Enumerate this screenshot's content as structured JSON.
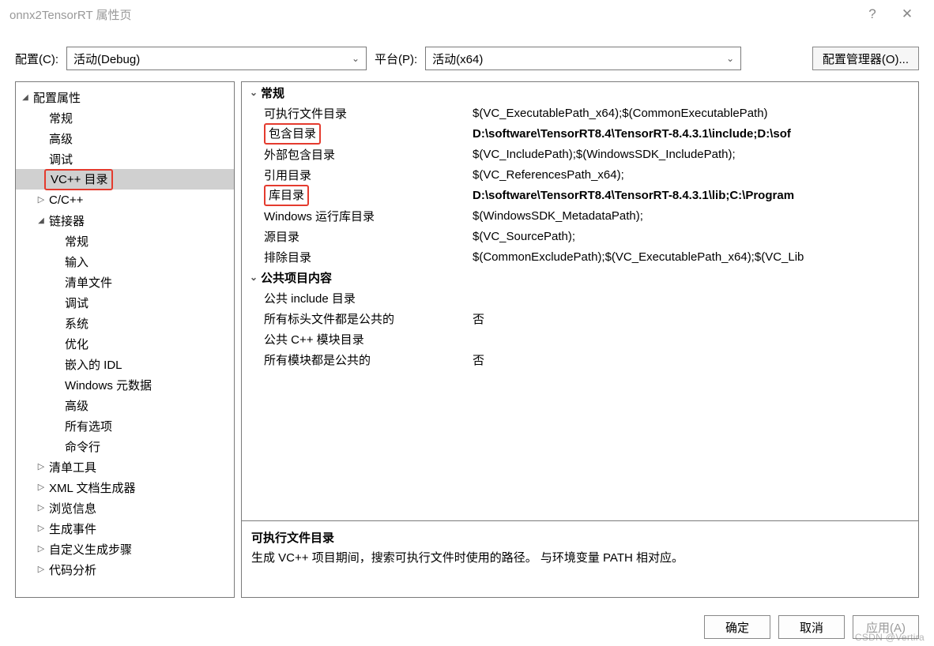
{
  "window": {
    "title": "onnx2TensorRT 属性页",
    "help_icon": "?",
    "close_icon": "✕"
  },
  "toolbar": {
    "config_label": "配置(C):",
    "config_value": "活动(Debug)",
    "platform_label": "平台(P):",
    "platform_value": "活动(x64)",
    "config_manager": "配置管理器(O)..."
  },
  "tree": [
    {
      "label": "配置属性",
      "depth": 0,
      "arrow": "open"
    },
    {
      "label": "常规",
      "depth": 1,
      "arrow": "none"
    },
    {
      "label": "高级",
      "depth": 1,
      "arrow": "none"
    },
    {
      "label": "调试",
      "depth": 1,
      "arrow": "none"
    },
    {
      "label": "VC++ 目录",
      "depth": 1,
      "arrow": "none",
      "selected": true,
      "redbox": true
    },
    {
      "label": "C/C++",
      "depth": 1,
      "arrow": "closed"
    },
    {
      "label": "链接器",
      "depth": 1,
      "arrow": "open"
    },
    {
      "label": "常规",
      "depth": 2,
      "arrow": "none"
    },
    {
      "label": "输入",
      "depth": 2,
      "arrow": "none"
    },
    {
      "label": "清单文件",
      "depth": 2,
      "arrow": "none"
    },
    {
      "label": "调试",
      "depth": 2,
      "arrow": "none"
    },
    {
      "label": "系统",
      "depth": 2,
      "arrow": "none"
    },
    {
      "label": "优化",
      "depth": 2,
      "arrow": "none"
    },
    {
      "label": "嵌入的 IDL",
      "depth": 2,
      "arrow": "none"
    },
    {
      "label": "Windows 元数据",
      "depth": 2,
      "arrow": "none"
    },
    {
      "label": "高级",
      "depth": 2,
      "arrow": "none"
    },
    {
      "label": "所有选项",
      "depth": 2,
      "arrow": "none"
    },
    {
      "label": "命令行",
      "depth": 2,
      "arrow": "none"
    },
    {
      "label": "清单工具",
      "depth": 1,
      "arrow": "closed"
    },
    {
      "label": "XML 文档生成器",
      "depth": 1,
      "arrow": "closed"
    },
    {
      "label": "浏览信息",
      "depth": 1,
      "arrow": "closed"
    },
    {
      "label": "生成事件",
      "depth": 1,
      "arrow": "closed"
    },
    {
      "label": "自定义生成步骤",
      "depth": 1,
      "arrow": "closed"
    },
    {
      "label": "代码分析",
      "depth": 1,
      "arrow": "closed"
    }
  ],
  "groups": [
    {
      "title": "常规",
      "rows": [
        {
          "name": "可执行文件目录",
          "value": "$(VC_ExecutablePath_x64);$(CommonExecutablePath)"
        },
        {
          "name": "包含目录",
          "value": "D:\\software\\TensorRT8.4\\TensorRT-8.4.3.1\\include;D:\\sof",
          "bold": true,
          "redbox": true
        },
        {
          "name": "外部包含目录",
          "value": "$(VC_IncludePath);$(WindowsSDK_IncludePath);"
        },
        {
          "name": "引用目录",
          "value": "$(VC_ReferencesPath_x64);"
        },
        {
          "name": "库目录",
          "value": "D:\\software\\TensorRT8.4\\TensorRT-8.4.3.1\\lib;C:\\Program",
          "bold": true,
          "redbox": true
        },
        {
          "name": "Windows 运行库目录",
          "value": "$(WindowsSDK_MetadataPath);"
        },
        {
          "name": "源目录",
          "value": "$(VC_SourcePath);"
        },
        {
          "name": "排除目录",
          "value": "$(CommonExcludePath);$(VC_ExecutablePath_x64);$(VC_Lib"
        }
      ]
    },
    {
      "title": "公共项目内容",
      "rows": [
        {
          "name": "公共 include 目录",
          "value": ""
        },
        {
          "name": "所有标头文件都是公共的",
          "value": "否"
        },
        {
          "name": "公共 C++ 模块目录",
          "value": ""
        },
        {
          "name": "所有模块都是公共的",
          "value": "否"
        }
      ]
    }
  ],
  "description": {
    "title": "可执行文件目录",
    "text": "生成 VC++ 项目期间，搜索可执行文件时使用的路径。  与环境变量 PATH 相对应。"
  },
  "buttons": {
    "ok": "确定",
    "cancel": "取消",
    "apply": "应用(A)"
  },
  "watermark": "CSDN @Vertira"
}
